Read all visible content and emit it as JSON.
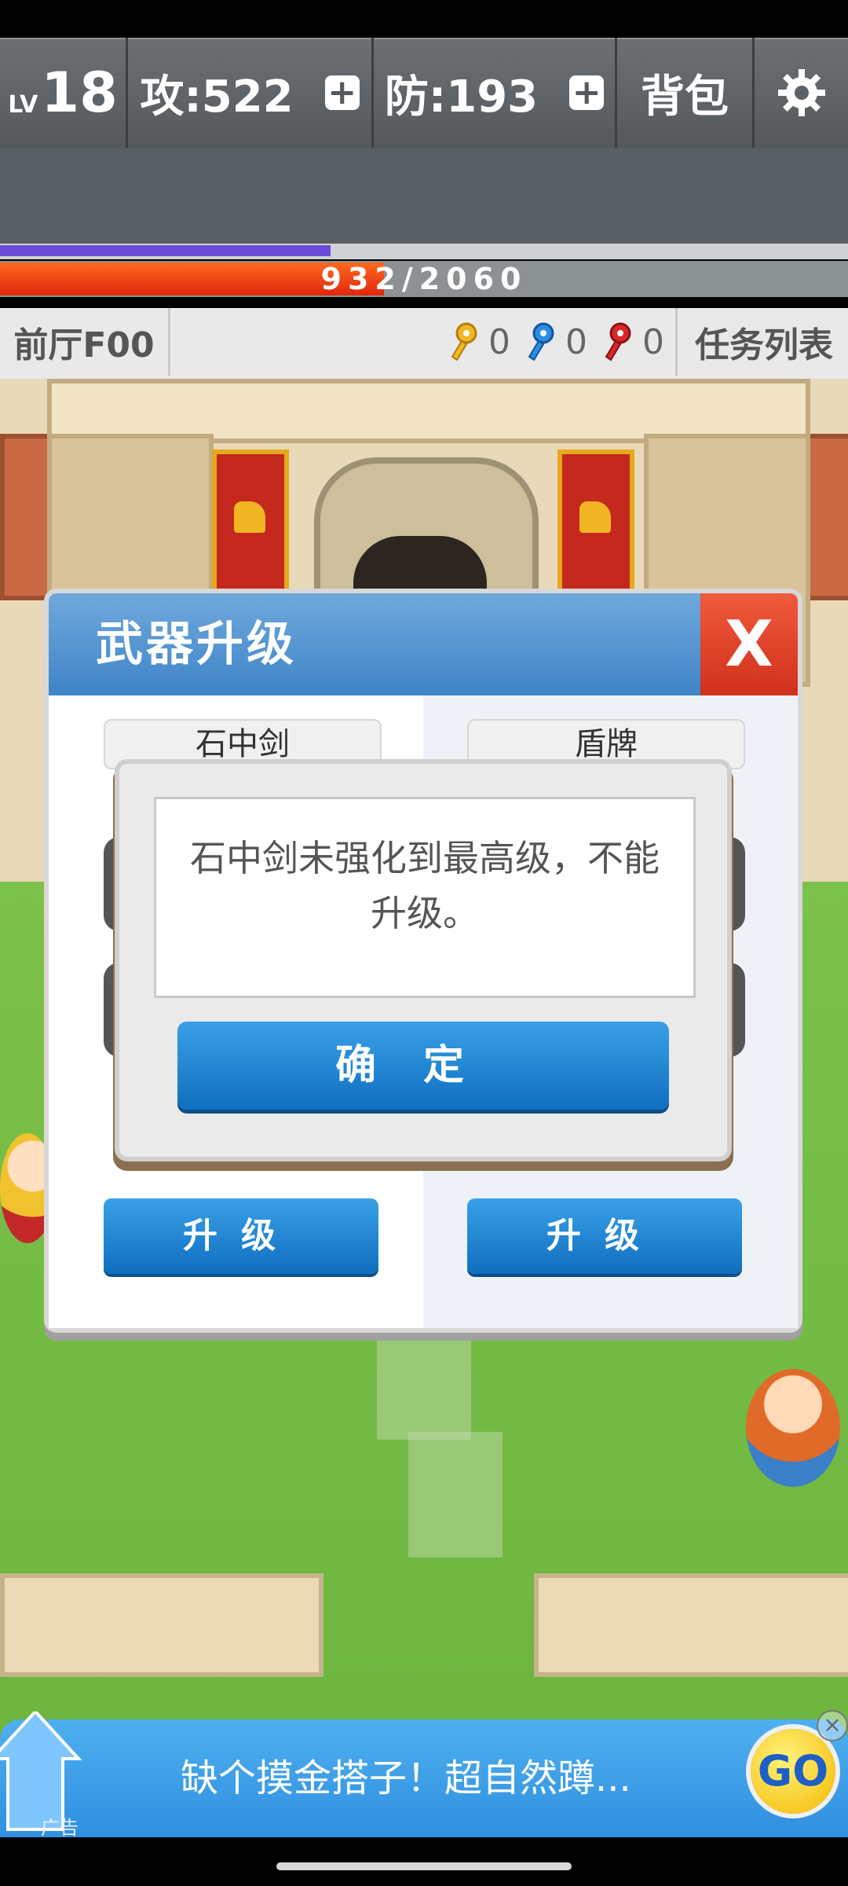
{
  "hud": {
    "level_prefix": "LV",
    "level": "18",
    "attack": "攻:522",
    "defense": "防:193",
    "backpack": "背包",
    "settings_icon": "gear-icon",
    "plus_icon": "plus-icon"
  },
  "bars": {
    "xp_progress": 0.39,
    "hp_current": 932,
    "hp_max": 2060,
    "hp_text": "932/2060"
  },
  "info": {
    "floor": "前厅F00",
    "keys": [
      {
        "icon": "yellow-key-icon",
        "color": "#f2b823",
        "count": "0"
      },
      {
        "icon": "blue-key-icon",
        "color": "#2a8fe0",
        "count": "0"
      },
      {
        "icon": "red-key-icon",
        "color": "#d8282a",
        "count": "0"
      }
    ],
    "task_list": "任务列表"
  },
  "weapon_dialog": {
    "title": "武器升级",
    "close": "X",
    "left_item": "石中剑",
    "right_item": "盾牌",
    "left_upgrade": "升级",
    "right_upgrade": "升级"
  },
  "alert": {
    "message": "石中剑未强化到最高级，不能升级。",
    "ok": "确定"
  },
  "ad": {
    "text": "缺个摸金搭子！超自然蹲...",
    "go": "GO",
    "label": "广告",
    "close": "×"
  },
  "colors": {
    "accent_blue": "#1a7fd0",
    "hp_red": "#e0260c",
    "xp_purple": "#6a4bd6"
  }
}
